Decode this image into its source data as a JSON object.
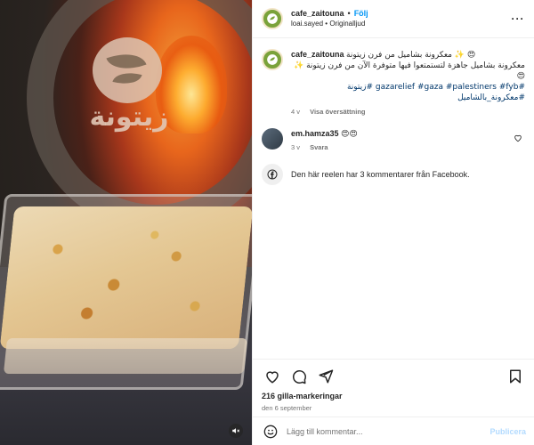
{
  "post": {
    "username": "cafe_zaitouna",
    "follow_label": "Följ",
    "separator": "•",
    "audio_user": "loai.sayed",
    "audio_label": "Originalljud",
    "more_label": "···"
  },
  "media": {
    "logo_text": "زيتونة",
    "mute_icon": "🔇"
  },
  "caption": {
    "username": "cafe_zaitouna",
    "line1": "معكرونة بشاميل من فرن زيتونة ✨ 😍",
    "line2": "معكرونة بشاميل جاهزة لتستمتعوا فيها متوفرة الآن من فرن زيتونة ✨ 😍",
    "tags_line": "#gazarelief #gaza #palestiners #fyb #زيتونة #معكرونة_بالشاميل",
    "time": "4 v",
    "translate_label": "Visa översättning"
  },
  "comments": [
    {
      "username": "em.hamza35",
      "text": "😍😍",
      "time": "3 v",
      "reply_label": "Svara"
    }
  ],
  "facebook_note": "Den här reelen har 3 kommentarer från Facebook.",
  "facebook_icon_label": "f",
  "stats": {
    "likes": "216 gilla-markeringar",
    "date": "den 6 september"
  },
  "add_comment": {
    "placeholder": "Lägg till kommentar...",
    "post_label": "Publicera"
  },
  "colors": {
    "accent": "#0095f6",
    "link": "#00376b",
    "muted": "#737373"
  }
}
